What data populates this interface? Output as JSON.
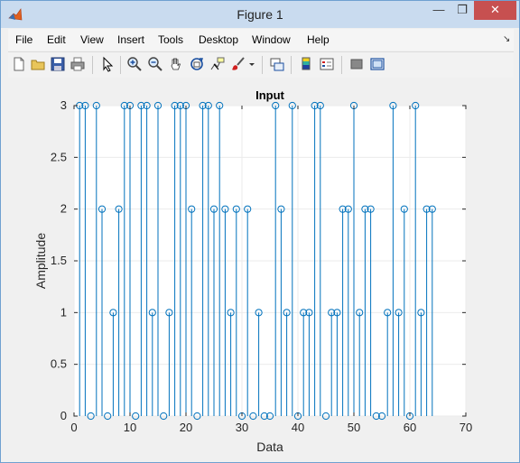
{
  "window": {
    "title": "Figure 1",
    "minimize_glyph": "—",
    "maximize_glyph": "❐",
    "close_glyph": "✕"
  },
  "menu": {
    "items": [
      "File",
      "Edit",
      "View",
      "Insert",
      "Tools",
      "Desktop",
      "Window",
      "Help"
    ],
    "overflow_glyph": "↘"
  },
  "toolbar": {
    "icons": [
      "new-figure-icon",
      "open-file-icon",
      "save-icon",
      "print-icon",
      "edit-plot-arrow-icon",
      "zoom-in-icon",
      "zoom-out-icon",
      "pan-hand-icon",
      "rotate-3d-icon",
      "data-cursor-icon",
      "brush-icon",
      "brush-dropdown-icon",
      "link-plot-icon",
      "colorbar-icon",
      "legend-icon",
      "hide-plot-tools-icon",
      "show-plot-tools-icon"
    ]
  },
  "colors": {
    "stem": "#0072bd",
    "accent": "#c9dbef",
    "close": "#c75050"
  },
  "chart_data": {
    "type": "stem",
    "title": "Input",
    "xlabel": "Data",
    "ylabel": "Amplitude",
    "xlim": [
      0,
      70
    ],
    "ylim": [
      0,
      3
    ],
    "xticks": [
      0,
      10,
      20,
      30,
      40,
      50,
      60,
      70
    ],
    "yticks": [
      0,
      0.5,
      1,
      1.5,
      2,
      2.5,
      3
    ],
    "ytick_labels": [
      "0",
      "0.5",
      "1",
      "1.5",
      "2",
      "2.5",
      "3"
    ],
    "grid": true,
    "x": [
      1,
      2,
      3,
      4,
      5,
      6,
      7,
      8,
      9,
      10,
      11,
      12,
      13,
      14,
      15,
      16,
      17,
      18,
      19,
      20,
      21,
      22,
      23,
      24,
      25,
      26,
      27,
      28,
      29,
      30,
      31,
      32,
      33,
      34,
      35,
      36,
      37,
      38,
      39,
      40,
      41,
      42,
      43,
      44,
      45,
      46,
      47,
      48,
      49,
      50,
      51,
      52,
      53,
      54,
      55,
      56,
      57,
      58,
      59,
      60,
      61,
      62,
      63,
      64
    ],
    "values": [
      3,
      3,
      0,
      3,
      2,
      0,
      1,
      2,
      3,
      3,
      0,
      3,
      3,
      1,
      3,
      0,
      1,
      3,
      3,
      3,
      2,
      0,
      3,
      3,
      2,
      3,
      2,
      1,
      2,
      0,
      2,
      0,
      1,
      0,
      0,
      3,
      2,
      1,
      3,
      0,
      1,
      1,
      3,
      3,
      0,
      1,
      1,
      2,
      2,
      3,
      1,
      2,
      2,
      0,
      0,
      1,
      3,
      1,
      2,
      0,
      3,
      1,
      2,
      2
    ]
  }
}
